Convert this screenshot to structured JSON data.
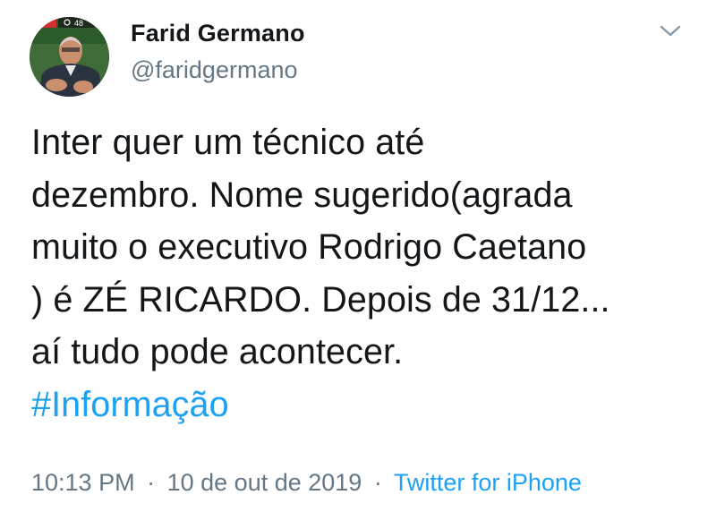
{
  "author": {
    "display_name": "Farid Germano",
    "handle": "@faridgermano",
    "avatar_badge_text": "ivo",
    "avatar_view_count": "48"
  },
  "menu": {
    "icon": "chevron-down-icon"
  },
  "tweet": {
    "lines": [
      "Inter quer um técnico até",
      "dezembro. Nome sugerido(agrada",
      "muito o executivo Rodrigo Caetano",
      ") é ZÉ RICARDO. Depois de 31/12...",
      "aí tudo pode acontecer."
    ],
    "hashtag": "#Informação"
  },
  "meta": {
    "time": "10:13 PM",
    "separator": "·",
    "date": "10 de out de 2019",
    "source": "Twitter for iPhone"
  },
  "colors": {
    "text": "#14171a",
    "muted": "#657786",
    "link": "#1da1f2"
  }
}
